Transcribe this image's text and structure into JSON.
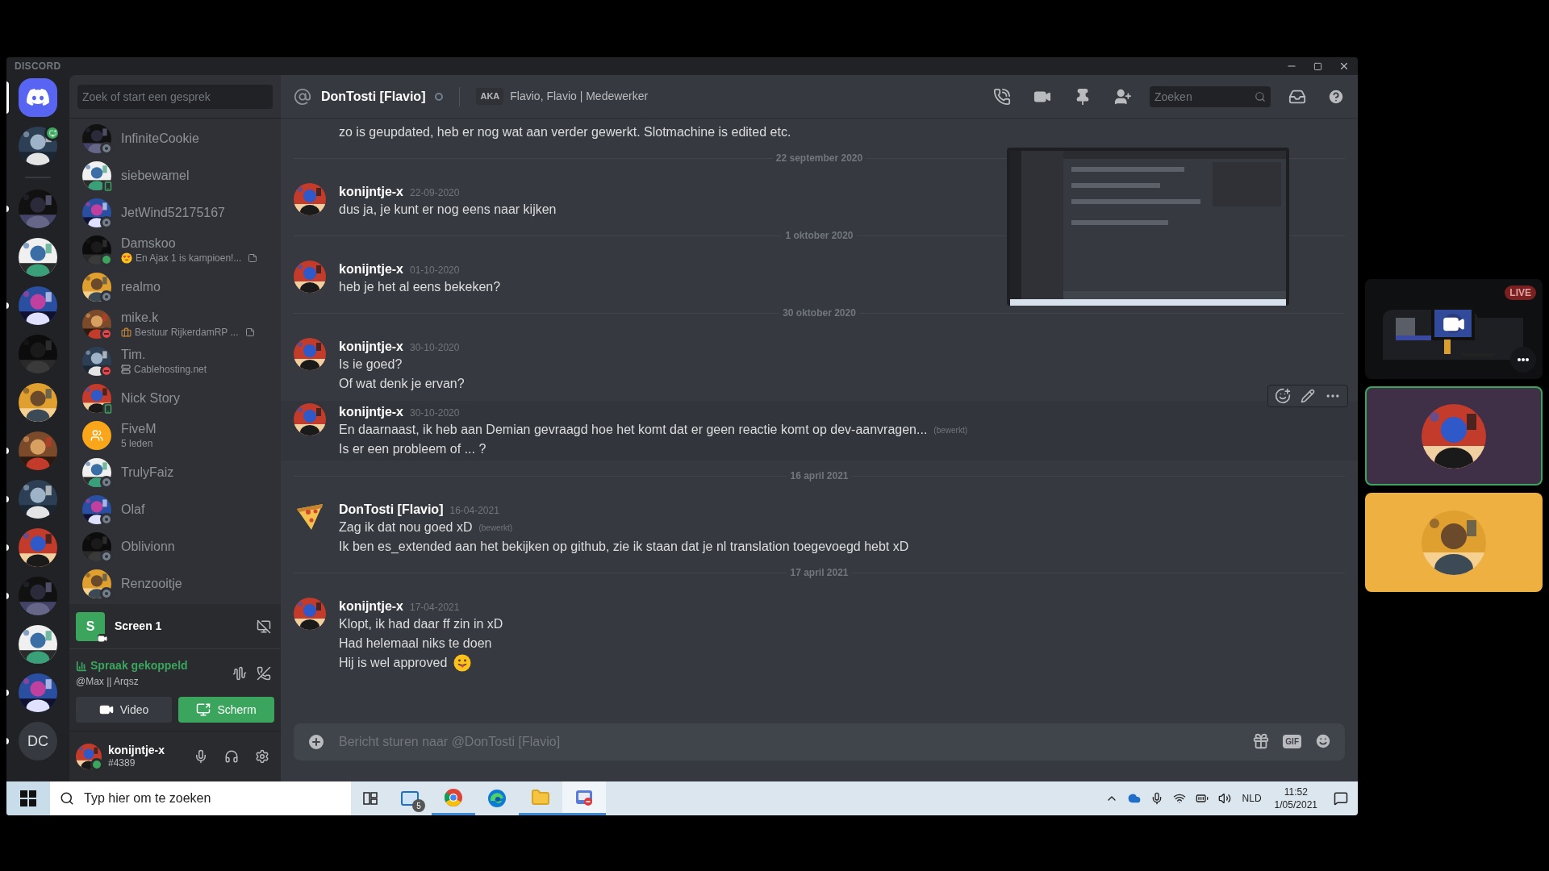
{
  "window": {
    "title": "DISCORD"
  },
  "servers": [
    {
      "kind": "home",
      "selected": true,
      "unread": false,
      "streaming": false
    },
    {
      "kind": "picture",
      "selected": false,
      "unread": false,
      "streaming": true
    },
    {
      "kind": "separator"
    },
    {
      "kind": "picture",
      "selected": false,
      "unread": true,
      "streaming": false
    },
    {
      "kind": "picture",
      "selected": false,
      "unread": false,
      "streaming": false
    },
    {
      "kind": "picture",
      "selected": false,
      "unread": true,
      "streaming": false
    },
    {
      "kind": "picture",
      "selected": false,
      "unread": false,
      "streaming": false
    },
    {
      "kind": "picture",
      "selected": false,
      "unread": false,
      "streaming": false
    },
    {
      "kind": "picture",
      "selected": false,
      "unread": true,
      "streaming": false
    },
    {
      "kind": "picture",
      "selected": false,
      "unread": true,
      "streaming": false
    },
    {
      "kind": "picture",
      "selected": false,
      "unread": true,
      "streaming": false
    },
    {
      "kind": "picture",
      "selected": false,
      "unread": true,
      "streaming": false
    },
    {
      "kind": "picture",
      "selected": false,
      "unread": false,
      "streaming": false
    },
    {
      "kind": "picture",
      "selected": false,
      "unread": true,
      "streaming": false
    },
    {
      "kind": "text",
      "label": "DC",
      "selected": false,
      "unread": true,
      "streaming": false
    }
  ],
  "dm_search": {
    "placeholder": "Zoek of start een gesprek"
  },
  "dms": [
    {
      "name": "InfiniteCookie",
      "kind": "user",
      "status": {
        "kind": "offline",
        "color": "#747f8d"
      },
      "note": false
    },
    {
      "name": "siebewamel",
      "kind": "user",
      "status": {
        "kind": "mobile",
        "color": "#3ba55d"
      },
      "note": false
    },
    {
      "name": "JetWind52175167",
      "kind": "user",
      "status": {
        "kind": "offline",
        "color": "#747f8d"
      },
      "note": false
    },
    {
      "name": "Damskoo",
      "kind": "user",
      "status": {
        "kind": "online",
        "color": "#3ba55d"
      },
      "activity": "En Ajax 1 is kampioen!...",
      "activity_icon": {
        "kind": "heart-eyes"
      },
      "note": true
    },
    {
      "name": "realmo",
      "kind": "user",
      "status": {
        "kind": "offline",
        "color": "#747f8d"
      },
      "note": false
    },
    {
      "name": "mike.k",
      "kind": "user",
      "status": {
        "kind": "dnd",
        "color": "#ed4245"
      },
      "activity": "Bestuur RijkerdamRP ...",
      "activity_icon": {
        "kind": "briefcase"
      },
      "note": true
    },
    {
      "name": "Tim.",
      "kind": "user",
      "status": {
        "kind": "dnd",
        "color": "#ed4245"
      },
      "activity": "Cablehosting.net",
      "activity_icon": {
        "kind": "server"
      },
      "note": false
    },
    {
      "name": "Nick Story",
      "kind": "user",
      "status": {
        "kind": "mobile",
        "color": "#3ba55d"
      },
      "note": false
    },
    {
      "name": "FiveM",
      "kind": "group",
      "activity": "5 leden",
      "note": false
    },
    {
      "name": "TrulyFaiz",
      "kind": "user",
      "status": {
        "kind": "offline",
        "color": "#747f8d"
      },
      "note": false
    },
    {
      "name": "Olaf",
      "kind": "user",
      "status": {
        "kind": "offline",
        "color": "#747f8d"
      },
      "note": false
    },
    {
      "name": "Oblivionn",
      "kind": "user",
      "status": {
        "kind": "offline",
        "color": "#747f8d"
      },
      "note": false
    },
    {
      "name": "Renzooitje",
      "kind": "user",
      "status": {
        "kind": "offline",
        "color": "#747f8d"
      },
      "note": false
    }
  ],
  "stream_panel": {
    "icon_letter": "S",
    "title": "Screen 1"
  },
  "voice_panel": {
    "status": "Spraak gekoppeld",
    "channel": "@Max || Arqsz",
    "buttons": [
      {
        "label": "Video",
        "kind": "video",
        "selected": false
      },
      {
        "label": "Scherm",
        "kind": "screen",
        "selected": true
      }
    ]
  },
  "user_panel": {
    "name": "konijntje-x",
    "tag": "#4389",
    "status": {
      "kind": "online",
      "color": "#3ba55d"
    }
  },
  "header": {
    "name": "DonTosti [Flavio]",
    "status": {
      "kind": "offline",
      "color": "#747f8d"
    },
    "aka_badge": "AKA",
    "aka": "Flavio, Flavio | Medewerker",
    "search": {
      "placeholder": "Zoeken"
    }
  },
  "feed": [
    {
      "kind": "message",
      "continuation": true,
      "hovered": false,
      "lines": [
        {
          "text": "zo is geupdated, heb er nog wat aan verder gewerkt. Slotmachine is edited etc."
        }
      ]
    },
    {
      "kind": "divider",
      "text": "22 september 2020"
    },
    {
      "kind": "message",
      "continuation": false,
      "hovered": false,
      "author": "konijntje-x",
      "time": "22-09-2020",
      "lines": [
        {
          "text": "dus ja, je kunt er nog eens naar kijken"
        }
      ]
    },
    {
      "kind": "divider",
      "text": "1 oktober 2020"
    },
    {
      "kind": "message",
      "continuation": false,
      "hovered": false,
      "author": "konijntje-x",
      "time": "01-10-2020",
      "lines": [
        {
          "text": "heb je het al eens bekeken?"
        }
      ]
    },
    {
      "kind": "divider",
      "text": "30 oktober 2020"
    },
    {
      "kind": "message",
      "continuation": false,
      "hovered": false,
      "author": "konijntje-x",
      "time": "30-10-2020",
      "lines": [
        {
          "text": "Is ie goed?"
        },
        {
          "text": "Of wat denk je ervan?"
        }
      ]
    },
    {
      "kind": "message",
      "continuation": false,
      "hovered": true,
      "author": "konijntje-x",
      "time": "30-10-2020",
      "lines": [
        {
          "text": "En daarnaast, ik heb aan Demian gevraagd hoe het komt dat er geen reactie komt op dev-aanvragen...",
          "edited_note": "(bewerkt)"
        },
        {
          "text": "Is er een probleem of ... ?"
        }
      ]
    },
    {
      "kind": "divider",
      "text": "16 april 2021"
    },
    {
      "kind": "message",
      "continuation": false,
      "hovered": false,
      "avatar": {
        "kind": "pizza"
      },
      "author": "DonTosti [Flavio]",
      "time": "16-04-2021",
      "lines": [
        {
          "text": "Zag ik dat nou goed xD",
          "edited_note": "(bewerkt)"
        },
        {
          "text": "Ik ben es_extended aan het bekijken op github, zie ik staan dat je nl translation toegevoegd hebt xD"
        }
      ]
    },
    {
      "kind": "divider",
      "text": "17 april 2021"
    },
    {
      "kind": "message",
      "continuation": false,
      "hovered": false,
      "author": "konijntje-x",
      "time": "17-04-2021",
      "lines": [
        {
          "text": "Klopt, ik had daar ff zin in xD"
        },
        {
          "text": "Had helemaal niks te doen"
        },
        {
          "text": "Hij is wel approved",
          "emoji": {
            "kind": "tongue"
          }
        }
      ]
    }
  ],
  "attachment": {
    "kind": "picture"
  },
  "composer": {
    "placeholder": "Bericht sturen naar @DonTosti [Flavio]",
    "gif_label": "GIF"
  },
  "tiles": [
    {
      "kind": "stream",
      "badge": "LIVE"
    },
    {
      "kind": "avatar",
      "speaking": true,
      "color": "#3f3048"
    },
    {
      "kind": "avatar",
      "speaking": false,
      "color": "#eeb040"
    }
  ],
  "taskbar": {
    "search": {
      "placeholder": "Typ hier om te zoeken"
    },
    "apps": [
      {
        "kind": "mail",
        "badge": "5",
        "running": false,
        "selected": false
      },
      {
        "kind": "chrome",
        "running": true,
        "selected": false
      },
      {
        "kind": "edge",
        "running": false,
        "selected": false
      },
      {
        "kind": "explorer",
        "running": true,
        "selected": false
      },
      {
        "kind": "discord",
        "running": true,
        "selected": true
      }
    ],
    "language": "NLD",
    "time": "11:52",
    "date": "1/05/2021"
  }
}
